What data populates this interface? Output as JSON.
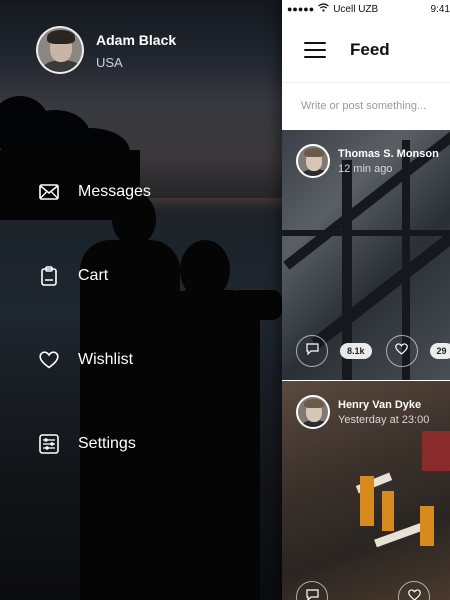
{
  "profile": {
    "name": "Adam Black",
    "country": "USA"
  },
  "menu": [
    {
      "label": "Messages",
      "icon": "envelope-icon"
    },
    {
      "label": "Cart",
      "icon": "clipboard-icon"
    },
    {
      "label": "Wishlist",
      "icon": "heart-icon"
    },
    {
      "label": "Settings",
      "icon": "sliders-icon"
    }
  ],
  "status": {
    "signal": "●●●●●",
    "carrier": "Ucell UZB",
    "time": "9:41"
  },
  "feed": {
    "title": "Feed",
    "composer_placeholder": "Write or post something...",
    "posts": [
      {
        "author": "Thomas S. Monson",
        "time": "12 min ago",
        "comments": "8.1k",
        "likes": "29"
      },
      {
        "author": "Henry Van Dyke",
        "time": "Yesterday at 23:00",
        "comments": "",
        "likes": ""
      }
    ]
  }
}
